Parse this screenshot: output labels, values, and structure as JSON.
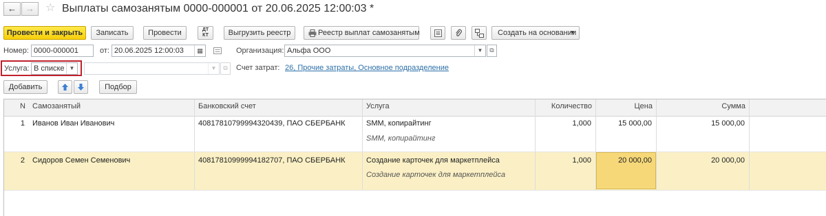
{
  "window": {
    "title": "Выплаты самозанятым 0000-000001 от 20.06.2025 12:00:03 *"
  },
  "toolbar": {
    "post_close": "Провести и закрыть",
    "save": "Записать",
    "post": "Провести",
    "dtkt": "ДТ КТ",
    "upload_registry": "Выгрузить реестр",
    "print_registry": "Реестр выплат самозанятым",
    "create_based": "Создать на основании"
  },
  "header": {
    "number_label": "Номер:",
    "number_value": "0000-000001",
    "date_label": "от:",
    "date_value": "20.06.2025 12:00:03",
    "org_label": "Организация:",
    "org_value": "Альфа ООО",
    "service_label": "Услуга:",
    "service_mode": "В списке",
    "cost_label": "Счет затрат:",
    "cost_value": "26, Прочие затраты, Основное подразделение"
  },
  "table_toolbar": {
    "add": "Добавить",
    "selection": "Подбор"
  },
  "table": {
    "columns": [
      "N",
      "Самозанятый",
      "Банковский счет",
      "Услуга",
      "Количество",
      "Цена",
      "Сумма"
    ],
    "rows": [
      {
        "n": "1",
        "person": "Иванов Иван Иванович",
        "account": "40817810799994320439, ПАО СБЕРБАНК",
        "service": "SMM, копирайтинг",
        "service_note": "SMM, копирайтинг",
        "qty": "1,000",
        "price": "15 000,00",
        "sum": "15 000,00"
      },
      {
        "n": "2",
        "person": "Сидоров Семен Семенович",
        "account": "40817810999994182707, ПАО СБЕРБАНК",
        "service": "Создание карточек для маркетплейса",
        "service_note": "Создание карточек для маркетплейса",
        "qty": "1,000",
        "price": "20 000,00",
        "sum": "20 000,00"
      }
    ]
  },
  "colors": {
    "primary": "#f7cf0a",
    "selected_row": "#fbf0c5",
    "active_cell": "#f6d879",
    "highlight_border": "#c0202a",
    "link": "#2d6fa8"
  },
  "icons": [
    "back-arrow-icon",
    "forward-arrow-icon",
    "star-icon",
    "dtkt-icon",
    "printer-icon",
    "list-icon",
    "paperclip-icon",
    "structure-icon",
    "calendar-icon",
    "comment-icon",
    "up-arrow-icon",
    "down-arrow-icon"
  ]
}
